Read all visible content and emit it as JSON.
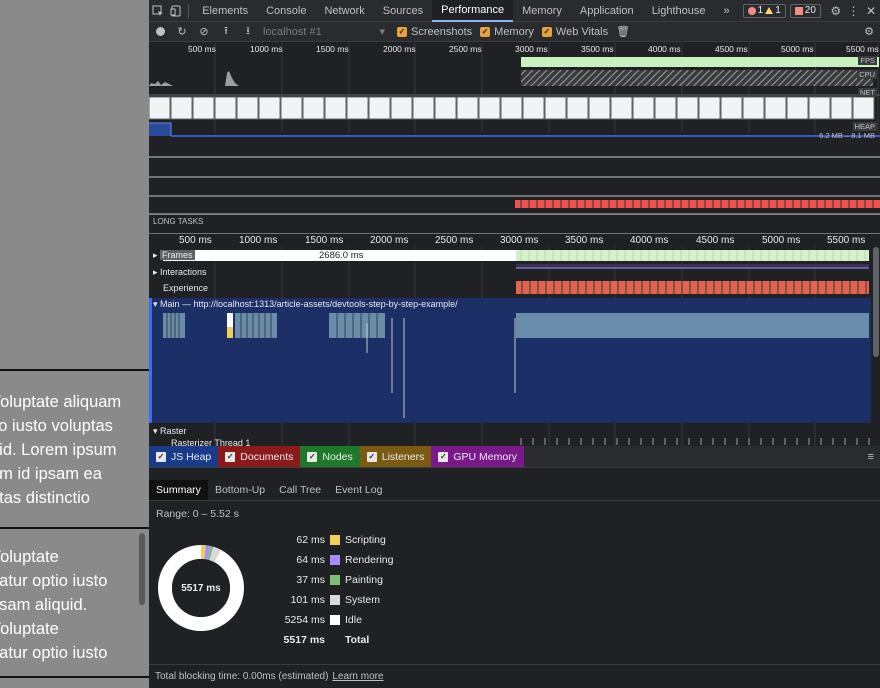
{
  "page": {
    "blocks": [
      [
        "Voluptate aliquam",
        "tio iusto voluptas",
        "uid. Lorem ipsum",
        "am id ipsam ea",
        "ptas distinctio"
      ],
      [
        "Voluptate",
        "riatur optio iusto",
        "psam aliquid.",
        "Voluptate",
        "riatur optio iusto"
      ]
    ]
  },
  "tabs": [
    "Elements",
    "Console",
    "Network",
    "Sources",
    "Performance",
    "Memory",
    "Application",
    "Lighthouse"
  ],
  "active_tab": "Performance",
  "more_tabs": "»",
  "badges": {
    "errors": "1",
    "warnings": "1",
    "issues": "20"
  },
  "toolbar": {
    "target": "localhost #1",
    "screenshots": "Screenshots",
    "memory": "Memory",
    "web_vitals": "Web Vitals"
  },
  "overview": {
    "ticks": [
      "500 ms",
      "1000 ms",
      "1500 ms",
      "2000 ms",
      "2500 ms",
      "3000 ms",
      "3500 ms",
      "4000 ms",
      "4500 ms",
      "5000 ms",
      "5500 ms"
    ],
    "fps_label": "FPS",
    "cpu_label": "CPU",
    "net_label": "NET",
    "heap_label": "HEAP",
    "heap_range": "6.2 MB – 8.1 MB",
    "long_tasks": "LONG TASKS"
  },
  "timeline": {
    "ticks": [
      "500 ms",
      "1000 ms",
      "1500 ms",
      "2000 ms",
      "2500 ms",
      "3000 ms",
      "3500 ms",
      "4000 ms",
      "4500 ms",
      "5000 ms",
      "5500 ms"
    ],
    "frames_label": "Frames",
    "frames_duration": "2686.0 ms",
    "interactions_label": "Interactions",
    "experience_label": "Experience",
    "main_label": "Main — http://localhost:1313/article-assets/devtools-step-by-step-example/",
    "raster_label": "Raster",
    "rasterizer_label": "Rasterizer Thread 1"
  },
  "legend": [
    {
      "label": "JS Heap",
      "color": "#1a3a8a"
    },
    {
      "label": "Documents",
      "color": "#8b1a1a"
    },
    {
      "label": "Nodes",
      "color": "#1e7a2a"
    },
    {
      "label": "Listeners",
      "color": "#7a5a10"
    },
    {
      "label": "GPU Memory",
      "color": "#7a1a8a"
    }
  ],
  "bottom_tabs": [
    "Summary",
    "Bottom-Up",
    "Call Tree",
    "Event Log"
  ],
  "range": "Range: 0 – 5.52 s",
  "summary": {
    "center": "5517 ms",
    "rows": [
      {
        "value": "62 ms",
        "label": "Scripting",
        "color": "#f2cd5c"
      },
      {
        "value": "64 ms",
        "label": "Rendering",
        "color": "#a58ef7"
      },
      {
        "value": "37 ms",
        "label": "Painting",
        "color": "#7cbf6e"
      },
      {
        "value": "101 ms",
        "label": "System",
        "color": "#d9d9d9"
      },
      {
        "value": "5254 ms",
        "label": "Idle",
        "color": "#ffffff"
      }
    ],
    "total_value": "5517 ms",
    "total_label": "Total"
  },
  "footer": {
    "text": "Total blocking time: 0.00ms (estimated)",
    "link": "Learn more"
  }
}
